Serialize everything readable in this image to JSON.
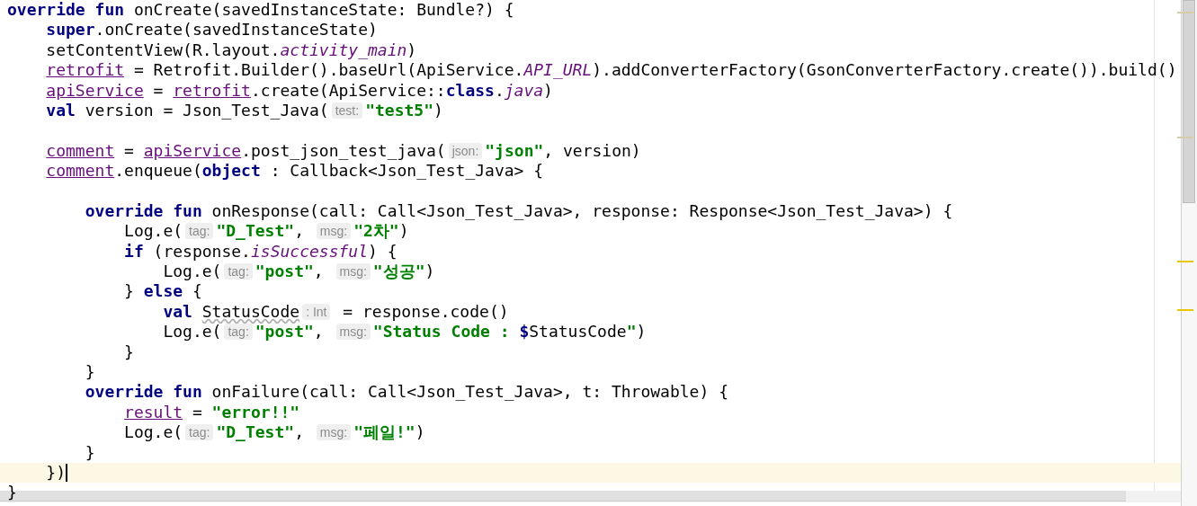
{
  "editor": {
    "lines": [
      {
        "current": false,
        "tokens": [
          {
            "kind": "keyword",
            "text": "override"
          },
          {
            "kind": "keyword",
            "text": " fun"
          },
          {
            "kind": "plain",
            "text": " onCreate(savedInstanceState: Bundle?) {"
          }
        ]
      },
      {
        "current": false,
        "tokens": [
          {
            "kind": "keyword",
            "text": "    super"
          },
          {
            "kind": "plain",
            "text": ".onCreate(savedInstanceState)"
          }
        ]
      },
      {
        "current": false,
        "tokens": [
          {
            "kind": "plain",
            "text": "    setContentView(R.layout."
          },
          {
            "kind": "static",
            "text": "activity_main"
          },
          {
            "kind": "plain",
            "text": ")"
          }
        ]
      },
      {
        "current": false,
        "tokens": [
          {
            "kind": "field",
            "text": "    retrofit"
          },
          {
            "kind": "plain",
            "text": " = Retrofit.Builder().baseUrl(ApiService."
          },
          {
            "kind": "static",
            "text": "API_URL"
          },
          {
            "kind": "plain",
            "text": ").addConverterFactory(GsonConverterFactory.create()).build()"
          }
        ]
      },
      {
        "current": false,
        "tokens": [
          {
            "kind": "field",
            "text": "    apiService"
          },
          {
            "kind": "plain",
            "text": " = "
          },
          {
            "kind": "field",
            "text": "retrofit"
          },
          {
            "kind": "plain",
            "text": ".create(ApiService::"
          },
          {
            "kind": "keyword",
            "text": "class"
          },
          {
            "kind": "plain",
            "text": "."
          },
          {
            "kind": "static",
            "text": "java"
          },
          {
            "kind": "plain",
            "text": ")"
          }
        ]
      },
      {
        "current": false,
        "tokens": [
          {
            "kind": "keyword",
            "text": "    val"
          },
          {
            "kind": "plain",
            "text": " version = Json_Test_Java("
          },
          {
            "kind": "hint",
            "text": "test:"
          },
          {
            "kind": "string",
            "text": "\"test5\""
          },
          {
            "kind": "plain",
            "text": ")"
          }
        ]
      },
      {
        "current": false
      },
      {
        "current": false,
        "tokens": [
          {
            "kind": "field",
            "text": "    comment"
          },
          {
            "kind": "plain",
            "text": " = "
          },
          {
            "kind": "field",
            "text": "apiService"
          },
          {
            "kind": "plain",
            "text": ".post_json_test_java("
          },
          {
            "kind": "hint",
            "text": "json:"
          },
          {
            "kind": "string",
            "text": "\"json\""
          },
          {
            "kind": "plain",
            "text": ", version)"
          }
        ]
      },
      {
        "current": false,
        "tokens": [
          {
            "kind": "field",
            "text": "    comment"
          },
          {
            "kind": "plain",
            "text": ".enqueue("
          },
          {
            "kind": "keyword",
            "text": "object"
          },
          {
            "kind": "plain",
            "text": " : Callback<Json_Test_Java> {"
          }
        ]
      },
      {
        "current": false
      },
      {
        "current": false,
        "tokens": [
          {
            "kind": "keyword",
            "text": "        override"
          },
          {
            "kind": "keyword",
            "text": " fun"
          },
          {
            "kind": "plain",
            "text": " onResponse(call: Call<Json_Test_Java>, response: Response<Json_Test_Java>) {"
          }
        ]
      },
      {
        "current": false,
        "tokens": [
          {
            "kind": "plain",
            "text": "            Log.e("
          },
          {
            "kind": "hint",
            "text": "tag:"
          },
          {
            "kind": "string",
            "text": "\"D_Test\""
          },
          {
            "kind": "plain",
            "text": ", "
          },
          {
            "kind": "hint",
            "text": "msg:"
          },
          {
            "kind": "string",
            "text": "\"2차\""
          },
          {
            "kind": "plain",
            "text": ")"
          }
        ]
      },
      {
        "current": false,
        "tokens": [
          {
            "kind": "keyword",
            "text": "            if"
          },
          {
            "kind": "plain",
            "text": " (response."
          },
          {
            "kind": "static",
            "text": "isSuccessful"
          },
          {
            "kind": "plain",
            "text": ") {"
          }
        ]
      },
      {
        "current": false,
        "tokens": [
          {
            "kind": "plain",
            "text": "                Log.e("
          },
          {
            "kind": "hint",
            "text": "tag:"
          },
          {
            "kind": "string",
            "text": "\"post\""
          },
          {
            "kind": "plain",
            "text": ", "
          },
          {
            "kind": "hint",
            "text": "msg:"
          },
          {
            "kind": "string",
            "text": "\"성공\""
          },
          {
            "kind": "plain",
            "text": ")"
          }
        ]
      },
      {
        "current": false,
        "tokens": [
          {
            "kind": "plain",
            "text": "            } "
          },
          {
            "kind": "keyword",
            "text": "else"
          },
          {
            "kind": "plain",
            "text": " {"
          }
        ]
      },
      {
        "current": false,
        "tokens": [
          {
            "kind": "keyword",
            "text": "                val"
          },
          {
            "kind": "warning",
            "text": " StatusCode"
          },
          {
            "kind": "hint",
            "text": ": Int"
          },
          {
            "kind": "plain",
            "text": " = response.code()"
          }
        ]
      },
      {
        "current": false,
        "tokens": [
          {
            "kind": "plain",
            "text": "                Log.e("
          },
          {
            "kind": "hint",
            "text": "tag:"
          },
          {
            "kind": "string",
            "text": "\"post\""
          },
          {
            "kind": "plain",
            "text": ", "
          },
          {
            "kind": "hint",
            "text": "msg:"
          },
          {
            "kind": "string",
            "text": "\"Status Code : "
          },
          {
            "kind": "keyword",
            "text": "$"
          },
          {
            "kind": "plain",
            "text": "StatusCode"
          },
          {
            "kind": "string",
            "text": "\""
          },
          {
            "kind": "plain",
            "text": ")"
          }
        ]
      },
      {
        "current": false,
        "tokens": [
          {
            "kind": "plain",
            "text": "            }"
          }
        ]
      },
      {
        "current": false,
        "tokens": [
          {
            "kind": "plain",
            "text": "        }"
          }
        ]
      },
      {
        "current": false,
        "tokens": [
          {
            "kind": "keyword",
            "text": "        override"
          },
          {
            "kind": "keyword",
            "text": " fun"
          },
          {
            "kind": "plain",
            "text": " onFailure(call: Call<Json_Test_Java>, t: Throwable) {"
          }
        ]
      },
      {
        "current": false,
        "tokens": [
          {
            "kind": "field",
            "text": "            result"
          },
          {
            "kind": "plain",
            "text": " = "
          },
          {
            "kind": "string",
            "text": "\"error!!\""
          }
        ]
      },
      {
        "current": false,
        "tokens": [
          {
            "kind": "plain",
            "text": "            Log.e("
          },
          {
            "kind": "hint",
            "text": "tag:"
          },
          {
            "kind": "string",
            "text": "\"D_Test\""
          },
          {
            "kind": "plain",
            "text": ", "
          },
          {
            "kind": "hint",
            "text": "msg:"
          },
          {
            "kind": "string",
            "text": "\"페일!\""
          },
          {
            "kind": "plain",
            "text": ")"
          }
        ]
      },
      {
        "current": false,
        "tokens": [
          {
            "kind": "plain",
            "text": "        }"
          }
        ]
      },
      {
        "current": true,
        "tokens": [
          {
            "kind": "plain",
            "text": "    })"
          }
        ]
      },
      {
        "current": false,
        "tokens": [
          {
            "kind": "plain",
            "text": "}"
          }
        ]
      }
    ]
  }
}
